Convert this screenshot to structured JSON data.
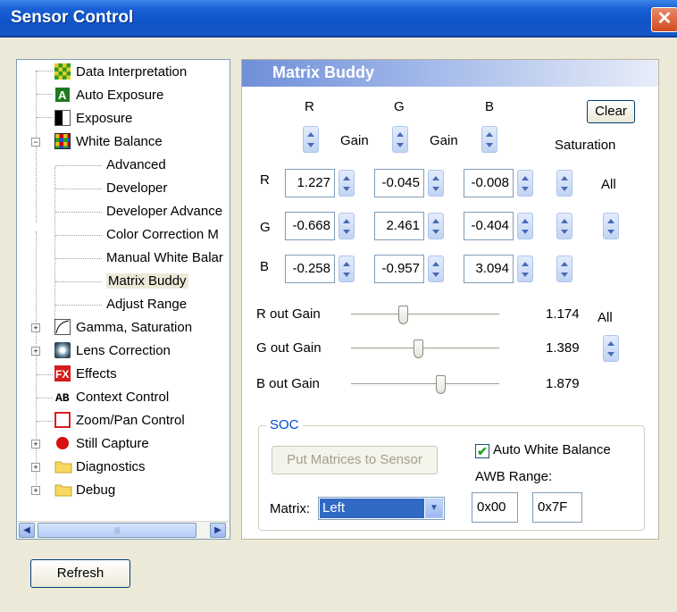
{
  "window": {
    "title": "Sensor Control",
    "close_glyph": "✕"
  },
  "tree": {
    "items": [
      {
        "label": "Data Interpretation",
        "icon": "checker-icon"
      },
      {
        "label": "Auto Exposure",
        "icon": "auto-exposure-icon"
      },
      {
        "label": "Exposure",
        "icon": "exposure-icon"
      },
      {
        "label": "White Balance",
        "icon": "white-balance-icon"
      },
      {
        "label": "Advanced"
      },
      {
        "label": "Developer"
      },
      {
        "label": "Developer Advance"
      },
      {
        "label": "Color Correction M"
      },
      {
        "label": "Manual White Balar"
      },
      {
        "label": "Matrix Buddy",
        "selected": true
      },
      {
        "label": "Adjust Range"
      },
      {
        "label": "Gamma, Saturation",
        "icon": "gamma-curve-icon"
      },
      {
        "label": "Lens Correction",
        "icon": "lens-icon"
      },
      {
        "label": "Effects",
        "icon": "fx-icon"
      },
      {
        "label": "Context Control",
        "icon": "ab-context-icon"
      },
      {
        "label": "Zoom/Pan Control",
        "icon": "zoom-pan-icon"
      },
      {
        "label": "Still Capture",
        "icon": "record-dot-icon"
      },
      {
        "label": "Diagnostics",
        "icon": "folder-icon"
      },
      {
        "label": "Debug",
        "icon": "folder-icon"
      }
    ],
    "scroll_thumb_grip": "|||"
  },
  "panel": {
    "title": "Matrix Buddy",
    "col_headers": [
      "R",
      "G",
      "B"
    ],
    "gain_label": "Gain",
    "clear_label": "Clear",
    "saturation_label": "Saturation",
    "all_label": "All",
    "row_labels": [
      "R",
      "G",
      "B"
    ],
    "matrix": [
      [
        "1.227",
        "-0.045",
        "-0.008"
      ],
      [
        "-0.668",
        "2.461",
        "-0.404"
      ],
      [
        "-0.258",
        "-0.957",
        "3.094"
      ]
    ],
    "out_gains": [
      {
        "label": "R out Gain",
        "value": "1.174",
        "position": 0.35
      },
      {
        "label": "G out Gain",
        "value": "1.389",
        "position": 0.45
      },
      {
        "label": "B out Gain",
        "value": "1.879",
        "position": 0.6
      }
    ],
    "out_all_label": "All"
  },
  "soc": {
    "title": "SOC",
    "put_button": "Put Matrices to Sensor",
    "awb_checkbox_label": "Auto White Balance",
    "awb_checked": true,
    "check_glyph": "✔",
    "awb_range_label": "AWB Range:",
    "awb_min": "0x00",
    "awb_max": "0x7F",
    "matrix_label": "Matrix:",
    "matrix_value": "Left"
  },
  "footer": {
    "refresh_label": "Refresh"
  }
}
